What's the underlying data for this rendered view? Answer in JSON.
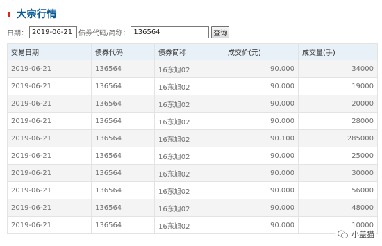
{
  "header": {
    "title": "大宗行情"
  },
  "search": {
    "date_label": "日期：",
    "date_value": "2019-06-21",
    "code_label": "债券代码/简称：",
    "code_value": "136564",
    "query_label": "查询"
  },
  "table": {
    "columns": [
      "交易日期",
      "债券代码",
      "债券简称",
      "成交价(元)",
      "成交量(手)"
    ],
    "rows": [
      [
        "2019-06-21",
        "136564",
        "16东旭02",
        "90.000",
        "34000"
      ],
      [
        "2019-06-21",
        "136564",
        "16东旭02",
        "90.000",
        "19000"
      ],
      [
        "2019-06-21",
        "136564",
        "16东旭02",
        "90.000",
        "20000"
      ],
      [
        "2019-06-21",
        "136564",
        "16东旭02",
        "90.000",
        "28000"
      ],
      [
        "2019-06-21",
        "136564",
        "16东旭02",
        "90.100",
        "285000"
      ],
      [
        "2019-06-21",
        "136564",
        "16东旭02",
        "90.000",
        "25000"
      ],
      [
        "2019-06-21",
        "136564",
        "16东旭02",
        "90.000",
        "30000"
      ],
      [
        "2019-06-21",
        "136564",
        "16东旭02",
        "90.000",
        "56000"
      ],
      [
        "2019-06-21",
        "136564",
        "16东旭02",
        "90.000",
        "48000"
      ],
      [
        "2019-06-21",
        "136564",
        "16东旭02",
        "90.000",
        "10000"
      ]
    ]
  },
  "watermark": {
    "text": "小盖猫",
    "icon": "wechat-icon"
  },
  "colors": {
    "title": "#0a5a96",
    "marker": "#e2231a",
    "header_bg": "#e9f1f8",
    "row_alt_bg": "#f4f4f4",
    "border": "#e3e3e3"
  }
}
